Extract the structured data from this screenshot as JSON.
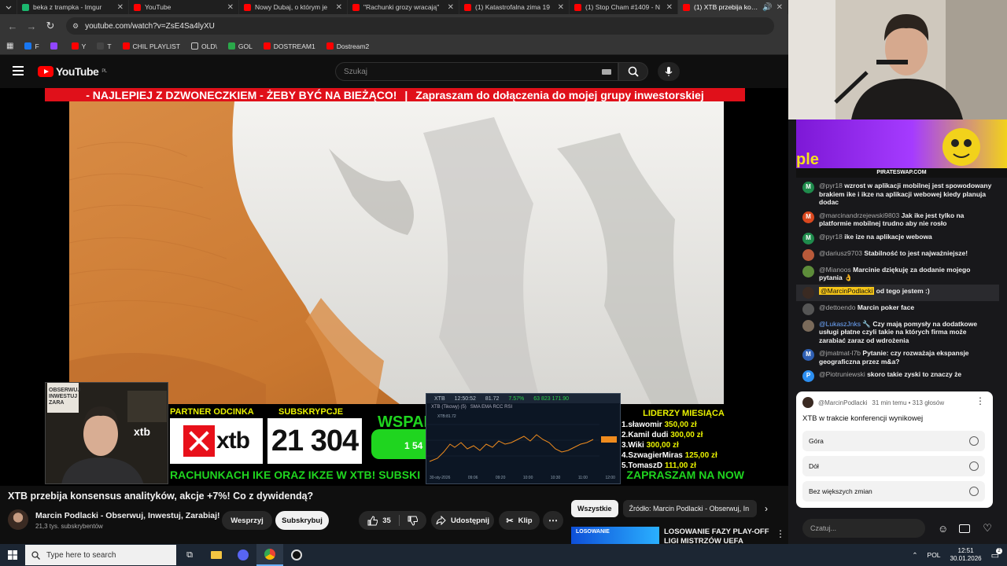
{
  "tabs": [
    {
      "label": "beka z trampka - Imgur",
      "color": "#1bb76e",
      "active": false
    },
    {
      "label": "YouTube",
      "color": "#ff0000",
      "active": false
    },
    {
      "label": "Nowy Dubaj, o którym je",
      "color": "#ff0000",
      "active": false
    },
    {
      "label": "\"Rachunki grozy wracają\"",
      "color": "#ff0000",
      "active": false
    },
    {
      "label": "(1) Katastrofalna zima 19",
      "color": "#ff0000",
      "active": false
    },
    {
      "label": "(1) Stop Cham #1409 - N",
      "color": "#ff0000",
      "active": false
    },
    {
      "label": "(1) XTB przebija konse",
      "color": "#ff0000",
      "active": true
    }
  ],
  "omnibox": {
    "url": "youtube.com/watch?v=ZsE4Sa4lyXU"
  },
  "bookmarks": [
    {
      "label": "F",
      "color": "#1877f2"
    },
    {
      "label": "",
      "color": "#9146ff"
    },
    {
      "label": "Y",
      "color": "#ff0000"
    },
    {
      "label": "T",
      "color": "#444444"
    },
    {
      "label": "CHIL PLAYLIST",
      "color": "#ff0000"
    },
    {
      "label": "OLD\\",
      "color": "#777777"
    },
    {
      "label": "GOL",
      "color": "#2aa84a"
    },
    {
      "label": "DOSTREAM1",
      "color": "#ff0000"
    },
    {
      "label": "Dostream2",
      "color": "#ff0000"
    }
  ],
  "header": {
    "logo_text": "YouTube",
    "logo_region": "PL",
    "search_placeholder": "Szukaj"
  },
  "video": {
    "banner_left": "- NAJLEPIEJ Z DZWONECZKIEM - ŻEBY BYĆ NA BIEŻĄCO!",
    "banner_sep": "|",
    "banner_right": "Zapraszam do dołączenia do mojej grupy inwestorskiej",
    "partner_label": "PARTNER ODCINKA",
    "subs_label": "SUBSKRYPCJE",
    "subs_count": "21 304",
    "xtb_logo": "xtb",
    "green_text": "WSPAI",
    "green_count": "1 54",
    "ticker_left": "RACHUNKACH IKE ORAZ IKZE W XTB! SUBSKI",
    "ticker_right": "ZAPRASZAM NA NOW",
    "cam_brand": "xtb",
    "cam_sign": "OBSERWUJ INWESTUJ ZARA",
    "leaders_title": "LIDERZY MIESIĄCA",
    "leaders": [
      {
        "name": "1.sławomir",
        "amount": "350,00 zł"
      },
      {
        "name": "2.Kamil dudi",
        "amount": "300,00 zł"
      },
      {
        "name": "3.Wiki",
        "amount": "300,00 zł"
      },
      {
        "name": "4.SzwagierMiras",
        "amount": "125,00 zł"
      },
      {
        "name": "5.TomaszD",
        "amount": "111,00 zł"
      }
    ],
    "chart": {
      "symbol": "XTB",
      "time": "12:50:52",
      "price": "81.72",
      "change": "7.57%",
      "volume": "63 823 171.90",
      "sub": "XTB (Tikowy) (5)",
      "sub2": "XTB:81.72",
      "tools": "SMA EMA RCC RSI",
      "xlabels": [
        "30-sty-2026",
        "09:06",
        "09:20",
        "10:00",
        "10:30",
        "11:00",
        "12:00"
      ]
    }
  },
  "info": {
    "title": "XTB przebija konsensus analityków, akcje +7%! Co z dywidendą?",
    "channel": "Marcin Podlacki - Obserwuj, Inwestuj, Zarabiaj!",
    "subs": "21,3 tys. subskrybentów",
    "support_btn": "Wesprzyj",
    "subscribe_btn": "Subskrybuj",
    "likes": "35",
    "share_btn": "Udostępnij",
    "clip_btn": "Klip",
    "chips": [
      "Wszystkie",
      "Źródło: Marcin Podlacki - Obserwuj, In"
    ],
    "rec_title": "LOSOWANIE FAZY PLAY-OFF LIGI MISTRZÓW UEFA",
    "rec_thumb_text": "LOSOWANIE"
  },
  "sidebar": {
    "sponsor_caption": "PIRATESWAP.COM",
    "sponsor_logo": "ple",
    "chat": [
      {
        "user": "@pyr18",
        "text": "wzrost w aplikacji mobilnej jest spowodowany brakiem ike i ikze na aplikacji webowej kiedy planuja dodac",
        "avatar": "M",
        "color": "#1f8b4c",
        "style": ""
      },
      {
        "user": "@marcinandrzejewski9803",
        "text": "Jak ike jest tylko na platformie mobilnej trudno aby nie rosło",
        "avatar": "M",
        "color": "#d9481f",
        "style": ""
      },
      {
        "user": "@pyr18",
        "text": "ike ize na aplikacje webowa",
        "avatar": "M",
        "color": "#1f8b4c",
        "style": ""
      },
      {
        "user": "@dariusz9703",
        "text": "Stabilność to jest najważniejsze!",
        "avatar": "",
        "color": "#b85a3a",
        "style": ""
      },
      {
        "user": "@Mianoos",
        "text": "Marcinie dziękuję za dodanie mojego pytania 👌",
        "avatar": "",
        "color": "#5d8c3a",
        "style": ""
      },
      {
        "user": "@MarcinPodlacki",
        "text": "od tego jestem :)",
        "avatar": "",
        "color": "#3a2a22",
        "style": "tag"
      },
      {
        "user": "@dettoendo",
        "text": "Marcin poker face",
        "avatar": "",
        "color": "#555555",
        "style": ""
      },
      {
        "user": "@LukaszJnks 🔧",
        "text": "Czy mają pomysły na dodatkowe usługi płatne czyli takie na których firma może zarabiać zaraz od wdrożenia",
        "avatar": "",
        "color": "#7a6a5a",
        "style": "blue"
      },
      {
        "user": "@jmatmat-l7b",
        "text": "Pytanie: czy rozważaja ekspansje geograficzna przez m&a?",
        "avatar": "M",
        "color": "#2f5fb3",
        "style": ""
      },
      {
        "user": "@Piotruniewski",
        "text": "skoro takie zyski to znaczy że",
        "avatar": "P",
        "color": "#2c8ef0",
        "style": ""
      }
    ],
    "poll": {
      "author": "@MarcinPodlacki",
      "meta": "31 min temu • 313 głosów",
      "question": "XTB w trakcie konferencji wynikowej",
      "options": [
        "Góra",
        "Dół",
        "Bez większych zmian"
      ]
    },
    "chat_placeholder": "Czatuj..."
  },
  "taskbar": {
    "search_placeholder": "Type here to search",
    "lang": "POL",
    "time": "12:51",
    "date": "30.01.2026",
    "notif": "2"
  },
  "colors": {
    "accent": "#ff0000",
    "banner": "#e0101a",
    "overlay_yellow": "#e9f200",
    "overlay_green": "#1fd51f"
  }
}
